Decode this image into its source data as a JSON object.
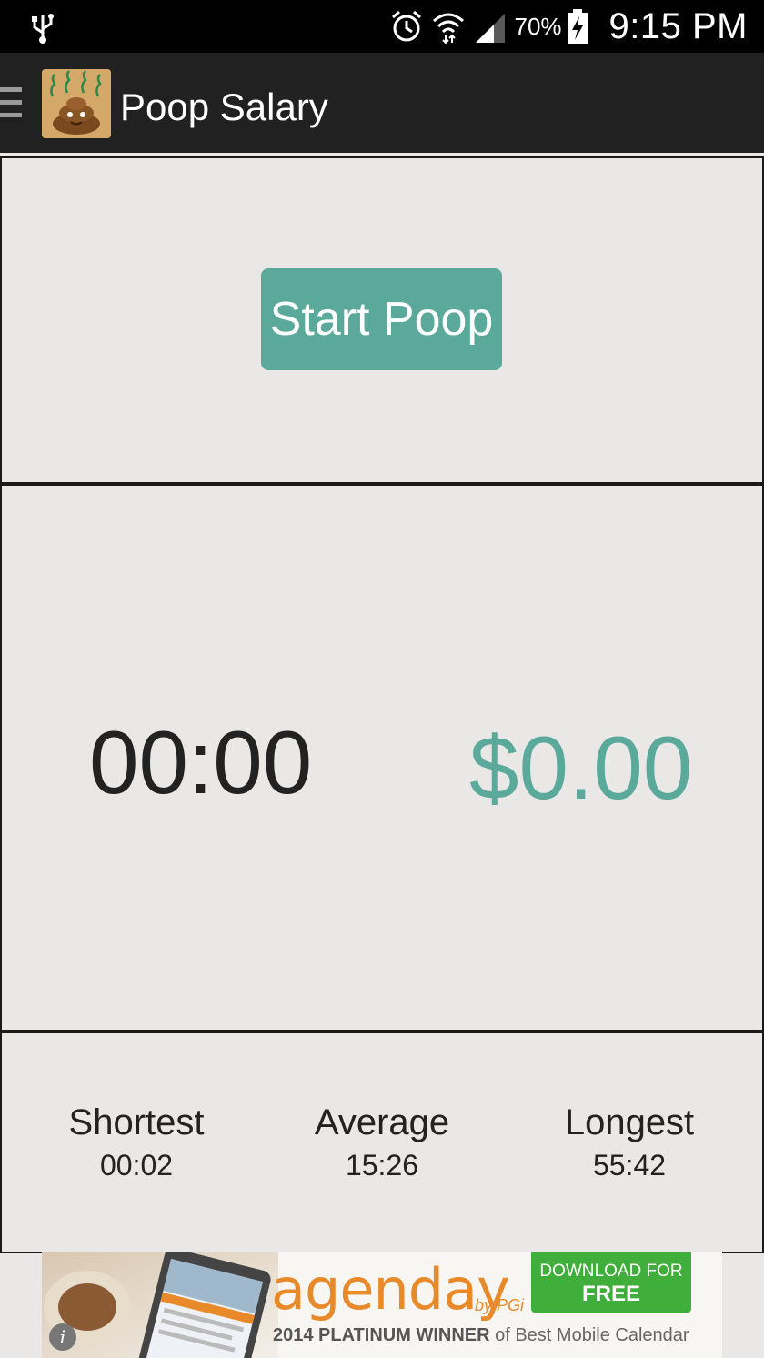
{
  "status_bar": {
    "battery_percent": "70%",
    "time": "9:15 PM",
    "icons": [
      "usb-icon",
      "alarm-icon",
      "wifi-icon",
      "signal-icon",
      "battery-charging-icon"
    ]
  },
  "action_bar": {
    "title": "Poop Salary",
    "drawer_icon": "hamburger-menu-icon",
    "logo_icon": "poop-money-logo-icon"
  },
  "controls": {
    "start_label": "Start Poop"
  },
  "session": {
    "timer": "00:00",
    "earnings": "$0.00"
  },
  "stats": [
    {
      "label": "Shortest",
      "value": "00:02"
    },
    {
      "label": "Average",
      "value": "15:26"
    },
    {
      "label": "Longest",
      "value": "55:42"
    }
  ],
  "ad": {
    "brand": "agenday",
    "by": "by PGi",
    "cta_line1": "DOWNLOAD FOR",
    "cta_line2": "FREE",
    "tagline_bold": "2014 PLATINUM WINNER",
    "tagline_rest": " of Best Mobile Calendar"
  },
  "colors": {
    "accent": "#5aa99a",
    "background": "#e9e8e6",
    "action_bar": "#212121",
    "status_bar": "#000000"
  }
}
